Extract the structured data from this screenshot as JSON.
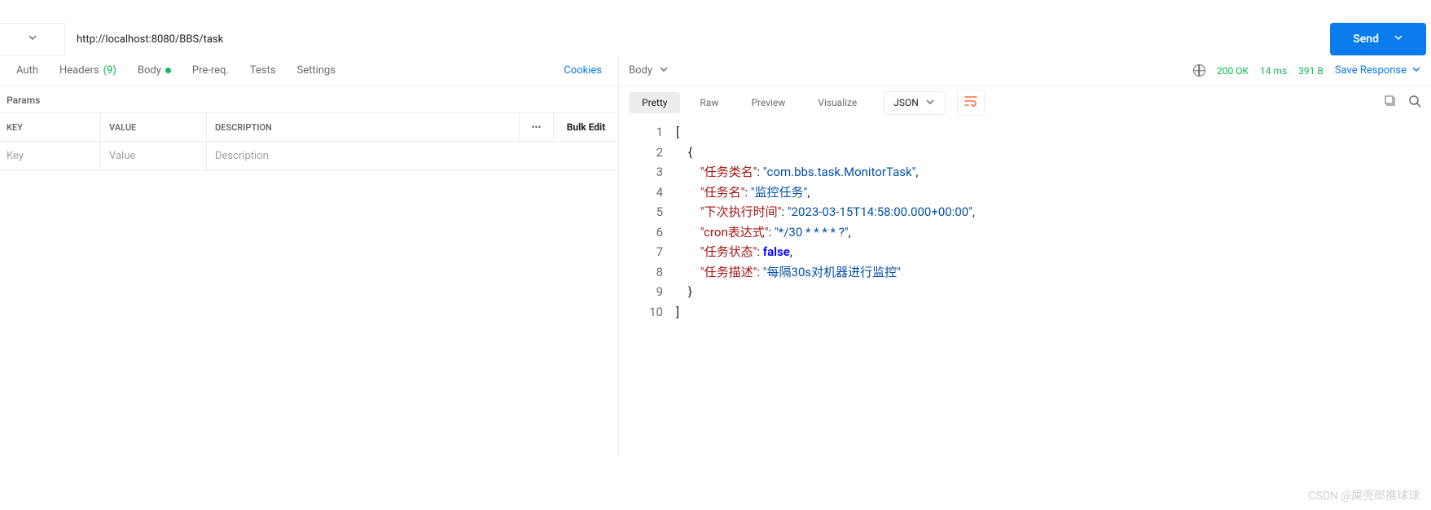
{
  "url": "http://localhost:8080/BBS/task",
  "send_label": "Send",
  "request_tabs": {
    "auth": "Auth",
    "headers": "Headers",
    "headers_count": "(9)",
    "body": "Body",
    "prereq": "Pre-req.",
    "tests": "Tests",
    "settings": "Settings",
    "cookies": "Cookies"
  },
  "params": {
    "section": "Params",
    "key_header": "KEY",
    "value_header": "VALUE",
    "desc_header": "DESCRIPTION",
    "bulk": "Bulk Edit",
    "key_ph": "Key",
    "value_ph": "Value",
    "desc_ph": "Description"
  },
  "response": {
    "body_label": "Body",
    "status": "200 OK",
    "time": "14 ms",
    "size": "391 B",
    "save": "Save Response",
    "views": {
      "pretty": "Pretty",
      "raw": "Raw",
      "preview": "Preview",
      "visualize": "Visualize"
    },
    "format": "JSON"
  },
  "chart_data": {
    "type": "table",
    "description": "JSON response body",
    "lines": [
      1,
      2,
      3,
      4,
      5,
      6,
      7,
      8,
      9,
      10
    ],
    "payload": [
      {
        "任务类名": "com.bbs.task.MonitorTask",
        "任务名": "监控任务",
        "下次执行时间": "2023-03-15T14:58:00.000+00:00",
        "cron表达式": "*/30 * * * * ?",
        "任务状态": false,
        "任务描述": "每隔30s对机器进行监控"
      }
    ]
  },
  "code_tokens": {
    "k1": "\"任务类名\"",
    "v1": "\"com.bbs.task.MonitorTask\"",
    "k2": "\"任务名\"",
    "v2": "\"监控任务\"",
    "k3": "\"下次执行时间\"",
    "v3": "\"2023-03-15T14:58:00.000+00:00\"",
    "k4": "\"cron表达式\"",
    "v4": "\"*/30 * * * * ?\"",
    "k5": "\"任务状态\"",
    "v5": "false",
    "k6": "\"任务描述\"",
    "v6": "\"每隔30s对机器进行监控\""
  },
  "watermark": "CSDN @屎壳郎推球球"
}
